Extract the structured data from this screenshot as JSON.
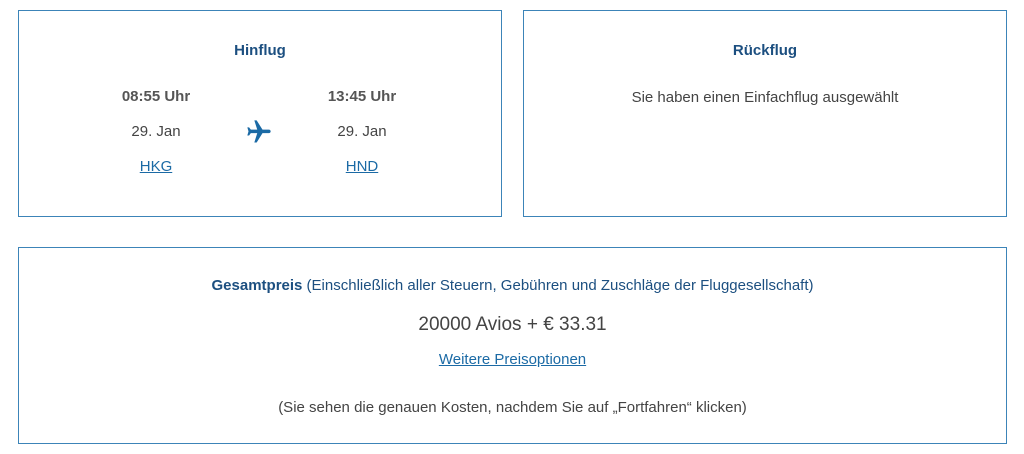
{
  "outbound": {
    "title": "Hinflug",
    "departure": {
      "time": "08:55 Uhr",
      "date": "29. Jan",
      "airport": "HKG"
    },
    "arrival": {
      "time": "13:45 Uhr",
      "date": "29. Jan",
      "airport": "HND"
    },
    "icon": "airplane-icon"
  },
  "return": {
    "title": "Rückflug",
    "message": "Sie haben einen Einfachflug ausgewählt"
  },
  "total": {
    "label": "Gesamtpreis",
    "label_note": " (Einschließlich aller Steuern, Gebühren und Zuschläge der Fluggesellschaft)",
    "amount": "20000 Avios + € 33.31",
    "more_options": "Weitere Preisoptionen",
    "note": "(Sie sehen die genauen Kosten, nachdem Sie auf „Fortfahren“ klicken)"
  },
  "colors": {
    "border": "#3c84b8",
    "heading": "#1c4f80",
    "link": "#1b6aa5"
  }
}
